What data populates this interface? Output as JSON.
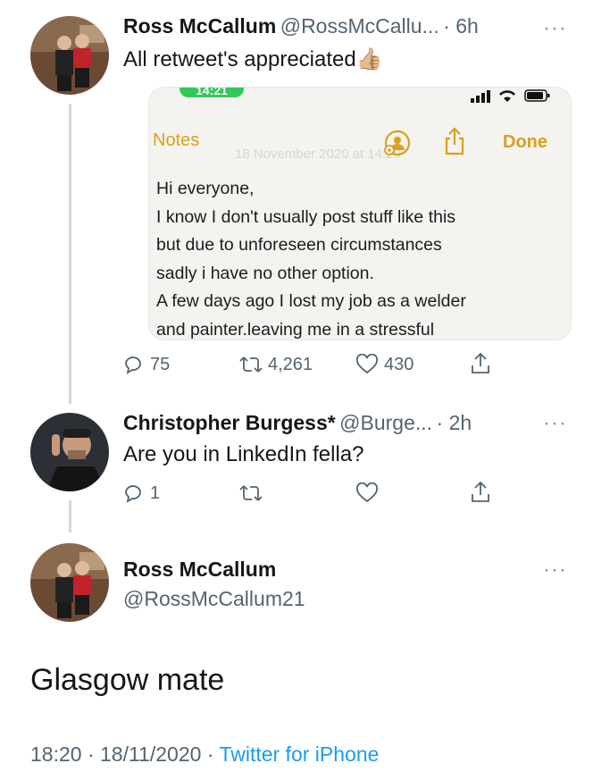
{
  "tweets": [
    {
      "name": "Ross McCallum",
      "handle": "@RossMcCallu...",
      "time": "· 6h",
      "text": "All retweet's appreciated",
      "emoji": "👍🏼",
      "stats": {
        "replies": "75",
        "retweets": "4,261",
        "likes": "430"
      }
    },
    {
      "name": "Christopher Burgess*",
      "handle": "@Burge...",
      "time": "· 2h",
      "text": "Are you in LinkedIn fella?",
      "stats": {
        "replies": "1"
      }
    }
  ],
  "notes_screenshot": {
    "status_time": "14:21",
    "back_label": "Notes",
    "done_label": "Done",
    "faint_date": "18 November 2020 at 14:20",
    "lines": [
      "Hi everyone,",
      "I know I don't usually post stuff like this",
      "but due to unforeseen circumstances",
      "sadly i have no other option.",
      "A few days ago I lost my job as a welder",
      "and painter.leaving me in a stressful"
    ]
  },
  "main_tweet": {
    "name": "Ross McCallum",
    "handle": "@RossMcCallum21",
    "text": "Glasgow mate",
    "timestamp": "18:20 · 18/11/2020 ·",
    "source": "Twitter for iPhone"
  },
  "more_glyph": "···",
  "colors": {
    "link": "#1d9bf0",
    "notes_accent": "#d7a21a",
    "status_pill": "#34c759",
    "thread_line": "#cfd9de"
  }
}
